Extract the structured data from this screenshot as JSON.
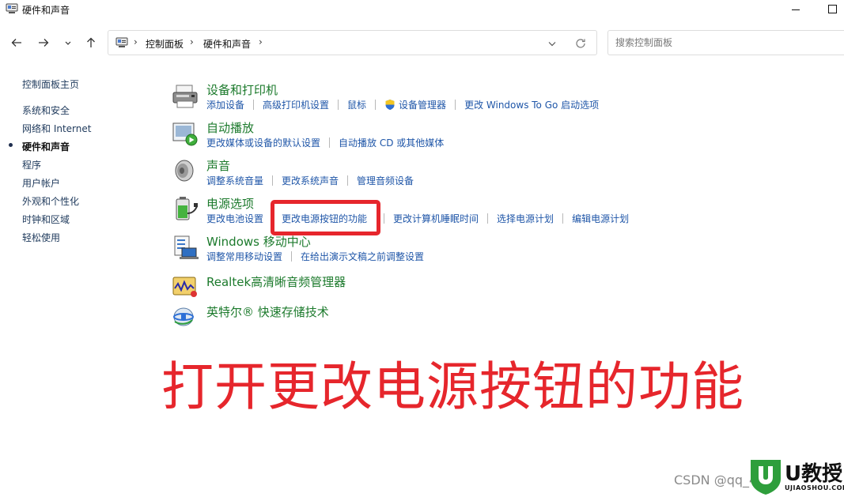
{
  "window": {
    "title": "硬件和声音"
  },
  "nav": {
    "back_icon": "arrow-left-icon",
    "forward_icon": "arrow-right-icon",
    "recent_icon": "chevron-down-icon",
    "up_icon": "arrow-up-icon"
  },
  "address": {
    "crumbs": [
      "控制面板",
      "硬件和声音"
    ],
    "separator": "›"
  },
  "search": {
    "placeholder": "搜索控制面板"
  },
  "sidebar": {
    "items": [
      {
        "label": "控制面板主页"
      },
      {
        "label": "系统和安全"
      },
      {
        "label": "网络和 Internet"
      },
      {
        "label": "硬件和声音",
        "active": true
      },
      {
        "label": "程序"
      },
      {
        "label": "用户帐户"
      },
      {
        "label": "外观和个性化"
      },
      {
        "label": "时钟和区域"
      },
      {
        "label": "轻松使用"
      }
    ]
  },
  "categories": [
    {
      "title": "设备和打印机",
      "icon": "printer-icon",
      "links": [
        "添加设备",
        "高级打印机设置",
        "鼠标",
        "设备管理器",
        "更改 Windows To Go 启动选项"
      ]
    },
    {
      "title": "自动播放",
      "icon": "autoplay-icon",
      "links": [
        "更改媒体或设备的默认设置",
        "自动播放 CD 或其他媒体"
      ]
    },
    {
      "title": "声音",
      "icon": "speaker-icon",
      "links": [
        "调整系统音量",
        "更改系统声音",
        "管理音频设备"
      ]
    },
    {
      "title": "电源选项",
      "icon": "battery-icon",
      "links": [
        "更改电池设置",
        "更改电源按钮的功能",
        "更改计算机睡眠时间",
        "选择电源计划",
        "编辑电源计划"
      ]
    },
    {
      "title": "Windows 移动中心",
      "icon": "mobility-center-icon",
      "links": [
        "调整常用移动设置",
        "在给出演示文稿之前调整设置"
      ]
    },
    {
      "title": "Realtek高清晰音频管理器",
      "icon": "realtek-audio-icon",
      "links": []
    },
    {
      "title": "英特尔® 快速存储技术",
      "icon": "intel-storage-icon",
      "links": []
    }
  ],
  "annotation": {
    "caption": "打开更改电源按钮的功能",
    "color": "#e6262c"
  },
  "watermark": {
    "text": "CSDN @qq_4"
  },
  "logo": {
    "brand": "U教授",
    "sub": "UJIAOSHOU.COM"
  },
  "colors": {
    "link": "#1f56a8",
    "category_title": "#1c7a2c",
    "highlight": "#e6262c"
  }
}
